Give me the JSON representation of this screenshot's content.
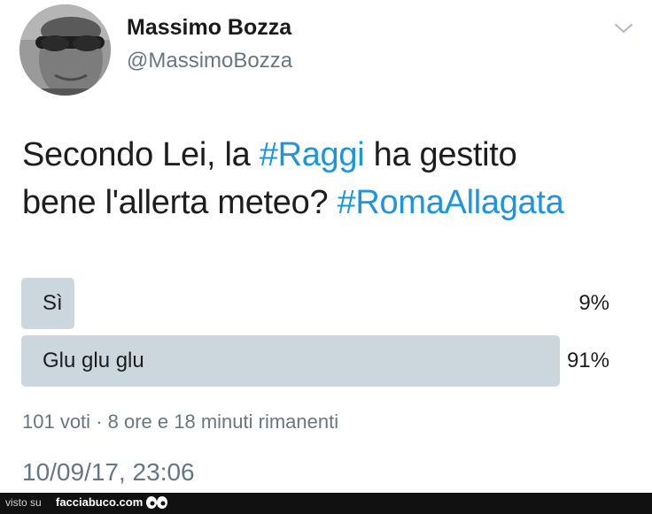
{
  "user": {
    "name": "Massimo Bozza",
    "handle": "@MassimoBozza"
  },
  "tweet": {
    "line1_pre": "Secondo Lei, la ",
    "line1_hashtag": "#Raggi",
    "line1_post": " ha gestito",
    "line2_pre": "bene l'allerta meteo? ",
    "line2_hashtag": "#RomaAllagata"
  },
  "poll": {
    "options": [
      {
        "label": "Sì",
        "percent_text": "9%",
        "percent": 9
      },
      {
        "label": "Glu glu glu",
        "percent_text": "91%",
        "percent": 91
      }
    ],
    "votes": "101 voti",
    "separator": "·",
    "time_left": "8 ore e 18 minuti rimanenti"
  },
  "timestamp": "10/09/17, 23:06",
  "footer": {
    "visto": "visto su",
    "site": "facciabuco.com"
  },
  "colors": {
    "hashtag": "#1b95e0",
    "poll_fill": "#ccd6dd",
    "secondary_text": "#657786"
  },
  "icons": [
    "avatar-photo",
    "chevron-down-icon",
    "eyes-icon"
  ]
}
